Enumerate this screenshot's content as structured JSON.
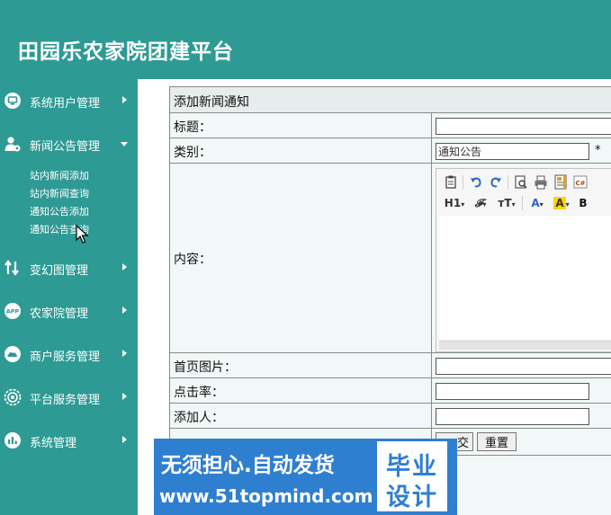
{
  "app": {
    "title": "田园乐农家院团建平台"
  },
  "colors": {
    "brand": "#2e9a94",
    "form_background": "#f1f8f7",
    "banner": "#2f7fd0"
  },
  "sidebar": {
    "items": [
      {
        "label": "系统用户管理",
        "icon": "monitor-icon"
      },
      {
        "label": "新闻公告管理",
        "icon": "user-gear-icon",
        "expanded": true,
        "children": [
          "站内新闻添加",
          "站内新闻查询",
          "通知公告添加",
          "通知公告查询"
        ]
      },
      {
        "label": "变幻图管理",
        "icon": "swap-arrows-icon"
      },
      {
        "label": "农家院管理",
        "icon": "app-icon",
        "icon_text": "APP"
      },
      {
        "label": "商户服务管理",
        "icon": "cloud-icon"
      },
      {
        "label": "平台服务管理",
        "icon": "gear-icon"
      },
      {
        "label": "系统管理",
        "icon": "chart-icon"
      }
    ]
  },
  "form": {
    "header": "添加新闻通知",
    "fields": {
      "title": {
        "label": "标题：",
        "value": ""
      },
      "category": {
        "label": "类别：",
        "value": "通知公告",
        "required_mark": "*"
      },
      "content": {
        "label": "内容："
      },
      "image": {
        "label": "首页图片：",
        "value": ""
      },
      "clicks": {
        "label": "点击率：",
        "value": ""
      },
      "author": {
        "label": "添加人：",
        "value": ""
      }
    },
    "editor_toolbar": {
      "row1": [
        "paste-icon",
        "undo-icon",
        "redo-icon",
        "preview-icon",
        "print-icon",
        "template-icon",
        "code-icon"
      ],
      "row2": [
        {
          "text": "H1",
          "icon": "heading-icon"
        },
        {
          "text": "𝓕",
          "icon": "font-family-icon"
        },
        {
          "text": "тT",
          "icon": "font-size-icon"
        },
        {
          "text": "A",
          "icon": "font-color-icon"
        },
        {
          "text": "A",
          "icon": "highlight-icon"
        },
        {
          "text": "B",
          "icon": "bold-icon"
        }
      ]
    },
    "buttons": {
      "submit": "交",
      "reset": "重置"
    }
  },
  "banner": {
    "line1": "无须担心.自动发货",
    "line2": "www.51topmind.com",
    "badge_line1": "毕业",
    "badge_line2": "设计"
  }
}
